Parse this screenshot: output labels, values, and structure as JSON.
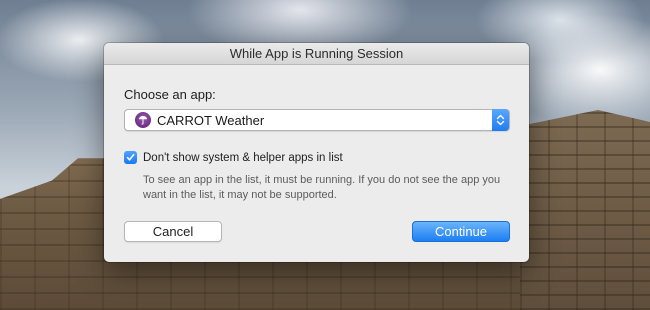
{
  "dialog": {
    "title": "While App is Running Session",
    "choose_label": "Choose an app:",
    "selected_app": {
      "name": "CARROT Weather",
      "icon": "carrot-weather-app-icon"
    },
    "checkbox": {
      "label": "Don't show system & helper apps in list",
      "checked": true
    },
    "help_text": "To see an app in the list, it must be running. If you do not see the app you want in the list, it may not be supported.",
    "buttons": {
      "cancel": "Cancel",
      "continue": "Continue"
    }
  },
  "colors": {
    "accent": "#1b7ff3",
    "dialog_bg": "#ececec"
  }
}
